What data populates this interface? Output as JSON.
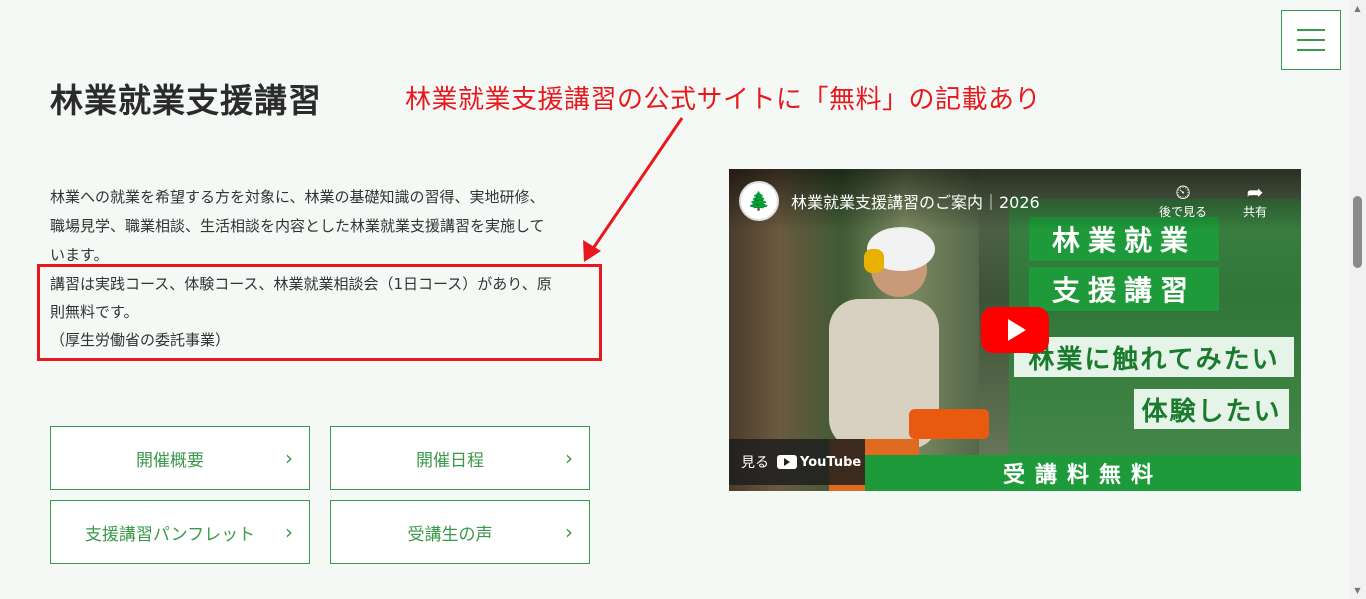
{
  "header": {
    "title": "林業就業支援講習",
    "annotation": "林業就業支援講習の公式サイトに「無料」の記載あり"
  },
  "intro": {
    "line1": "林業への就業を希望する方を対象に、林業の基礎知識の習得、実地研修、",
    "line2": "職場見学、職業相談、生活相談を内容とした林業就業支援講習を実施して",
    "line3": "います。",
    "highlight1": "講習は実践コース、体験コース、林業就業相談会（1日コース）があり、原",
    "highlight2": "則無料です。",
    "highlight3": "（厚生労働省の委託事業）"
  },
  "buttons": [
    {
      "label": "開催概要",
      "chevron": "›"
    },
    {
      "label": "開催日程",
      "chevron": "›"
    },
    {
      "label": "支援講習パンフレット",
      "chevron": "›"
    },
    {
      "label": "受講生の声",
      "chevron": "›"
    }
  ],
  "video": {
    "title": "林業就業支援講習のご案内｜2026",
    "watch_later": "後で見る",
    "share": "共有",
    "watch_label": "見る",
    "youtube": "YouTube",
    "overlay1": "林業就業",
    "overlay2": "支援講習",
    "overlay3": "林業に触れてみたい",
    "overlay4": "体験したい",
    "overlay5": "受講料無料"
  },
  "colors": {
    "accent": "#3a9a4a",
    "annotation": "#e8191e",
    "background": "#f5f9f6"
  },
  "icons": [
    "hamburger-icon",
    "chevron-right-icon",
    "clock-icon",
    "share-icon",
    "play-icon",
    "youtube-icon"
  ]
}
